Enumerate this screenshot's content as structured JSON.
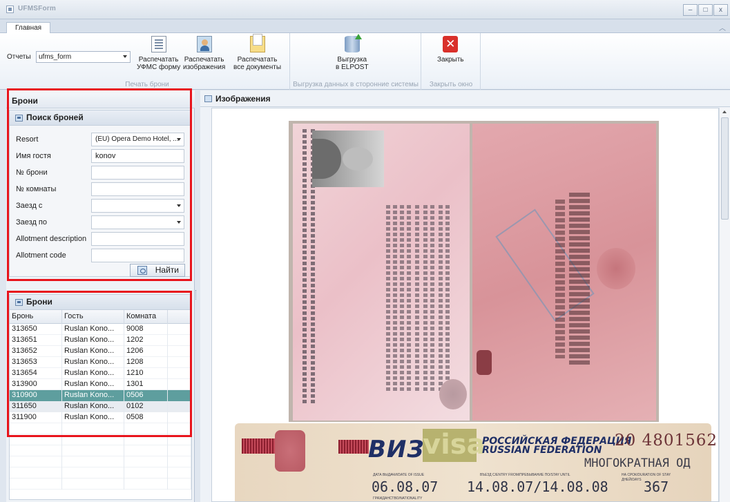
{
  "window": {
    "title": "UFMSForm",
    "buttons": [
      "–",
      "□",
      "x"
    ]
  },
  "ribbon": {
    "tabs": [
      {
        "label": "Главная"
      }
    ],
    "reports": {
      "label": "Отчеты",
      "value": "ufms_form"
    },
    "groups": {
      "print": {
        "label": "Печать брони",
        "buttons": [
          {
            "line1": "Распечатать",
            "line2": "УФМС форму",
            "icon": "document-icon"
          },
          {
            "line1": "Распечатать",
            "line2": "изображения",
            "icon": "person-image-icon"
          },
          {
            "line1": "Распечатать",
            "line2": "все документы",
            "icon": "folder-icon"
          }
        ]
      },
      "export": {
        "label": "Выгрузка данных в сторонние системы",
        "buttons": [
          {
            "line1": "Выгрузка",
            "line2": "в ELPOST",
            "icon": "database-upload-icon"
          }
        ]
      },
      "close": {
        "label": "Закрыть окно",
        "buttons": [
          {
            "line1": "Закрыть",
            "icon": "close-icon"
          }
        ]
      }
    }
  },
  "left": {
    "title": "Брони",
    "search": {
      "title": "Поиск броней",
      "fields": [
        {
          "label": "Resort",
          "value": "(EU) Opera Demo Hotel, ...",
          "dropdown": true
        },
        {
          "label": "Имя гостя",
          "value": "konov",
          "dropdown": false
        },
        {
          "label": "№ брони",
          "value": "",
          "dropdown": false
        },
        {
          "label": "№ комнаты",
          "value": "",
          "dropdown": false
        },
        {
          "label": "Заезд с",
          "value": "",
          "dropdown": true
        },
        {
          "label": "Заезд по",
          "value": "",
          "dropdown": true
        },
        {
          "label": "Allotment description",
          "value": "",
          "dropdown": false
        },
        {
          "label": "Allotment code",
          "value": "",
          "dropdown": false
        }
      ],
      "find_label": "Найти"
    },
    "bookings": {
      "title": "Брони",
      "columns": [
        "Бронь",
        "Гость",
        "Комната"
      ],
      "rows": [
        [
          "313650",
          "Ruslan Kono...",
          "9008"
        ],
        [
          "313651",
          "Ruslan Kono...",
          "1202"
        ],
        [
          "313652",
          "Ruslan Kono...",
          "1206"
        ],
        [
          "313653",
          "Ruslan Kono...",
          "1208"
        ],
        [
          "313654",
          "Ruslan Kono...",
          "1210"
        ],
        [
          "313900",
          "Ruslan Kono...",
          "1301"
        ],
        [
          "310900",
          "Ruslan Kono...",
          "0506"
        ],
        [
          "311650",
          "Ruslan Kono...",
          "0102"
        ],
        [
          "311900",
          "Ruslan Kono...",
          "0508"
        ]
      ],
      "selected_row": 6,
      "hover_row": 7
    }
  },
  "images": {
    "title": "Изображения",
    "visa": {
      "word_ru": "ВИЗА",
      "word_en": "visa",
      "country_ru": "РОССИЙСКАЯ ФЕДЕРАЦИЯ",
      "country_en": "RUSSIAN FEDERATION",
      "number": "20 4801562",
      "type": "МНОГОКРАТНАЯ ОД",
      "issue_label": "ДАТА ВЫДАЧИ/DATE OF ISSUE",
      "entry_label": "ВЪЕЗД С/ENTRY FROM/ПРЕБЫВАНИЕ ПО/STAY UNTIL",
      "duration_label": "НА СРОК/DURATION OF STAY",
      "duration_unit": "ДНЕЙ/DAYS",
      "nationality_label": "ГРАЖДАНСТВО/NATIONALITY",
      "issue_date": "06.08.07",
      "entry_dates": "14.08.07/14.08.08",
      "duration": "367"
    }
  },
  "colors": {
    "highlight_frame": "#e8141c",
    "selected_row": "#5e9e9e"
  }
}
